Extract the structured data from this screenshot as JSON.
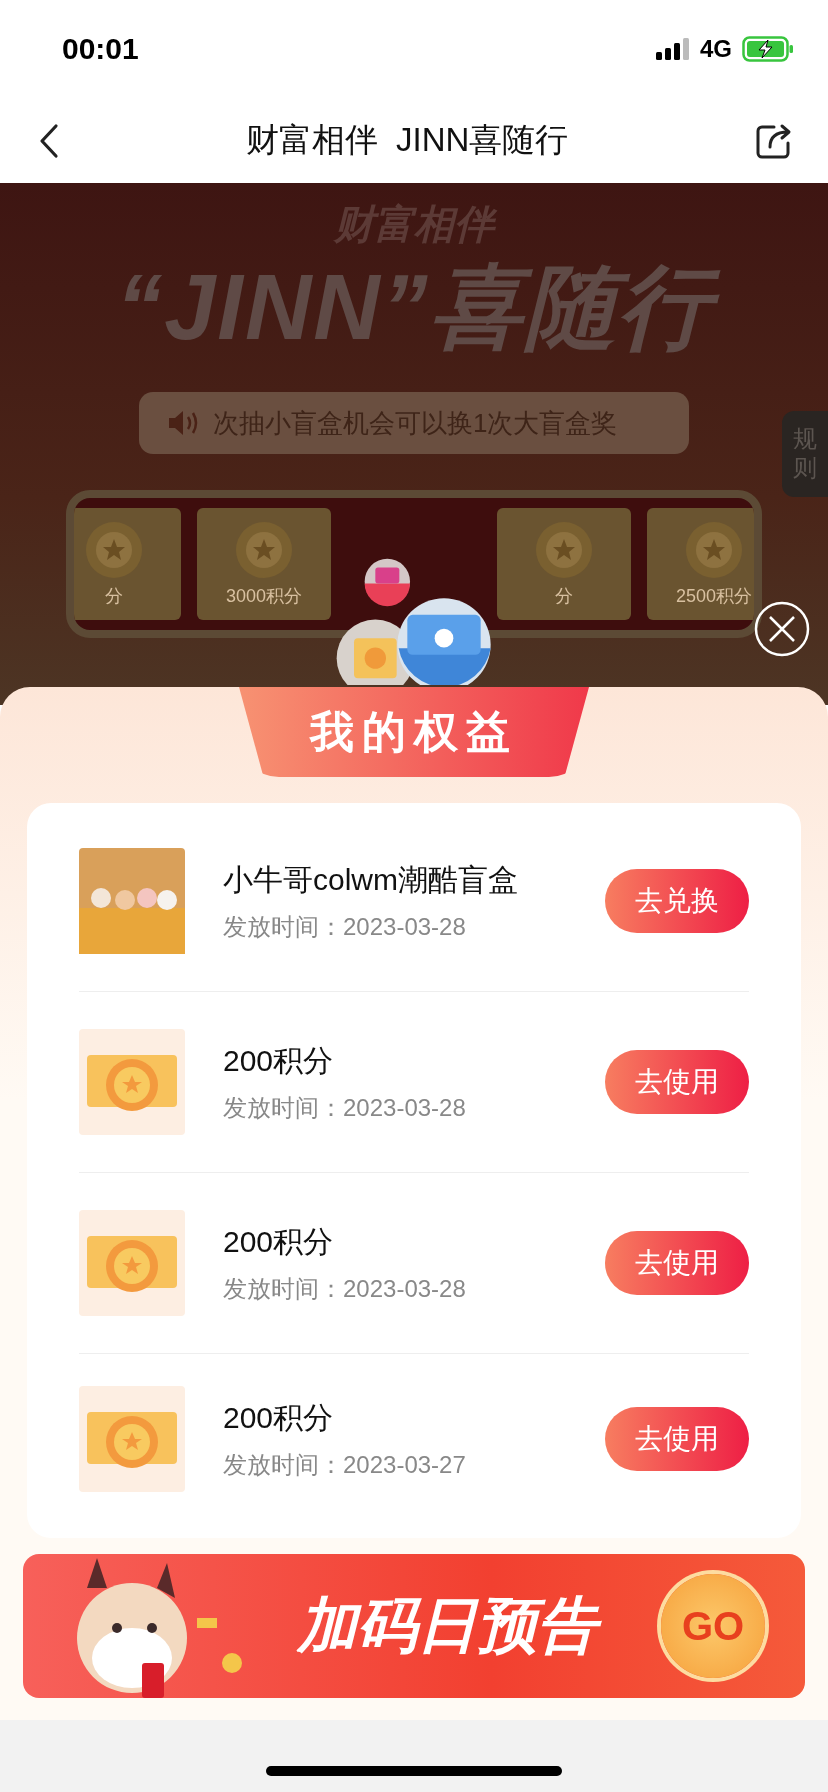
{
  "status_bar": {
    "time": "00:01",
    "network": "4G"
  },
  "nav": {
    "title": "财富相伴  JINN喜随行"
  },
  "background": {
    "subtitle": "财富相伴",
    "title": "“JINN”喜随行",
    "notice": "次抽小盲盒机会可以换1次大盲盒奖",
    "rules_tab": "规则",
    "prizes": [
      {
        "label": "分"
      },
      {
        "label": "3000积分"
      },
      {
        "label": "分"
      },
      {
        "label": "2500积分"
      }
    ]
  },
  "sheet": {
    "title": "我的权益",
    "items": [
      {
        "kind": "figure",
        "name": "小牛哥colwm潮酷盲盒",
        "date": "发放时间：2023-03-28",
        "action": "去兑换"
      },
      {
        "kind": "points",
        "name": "200积分",
        "date": "发放时间：2023-03-28",
        "action": "去使用"
      },
      {
        "kind": "points",
        "name": "200积分",
        "date": "发放时间：2023-03-28",
        "action": "去使用"
      },
      {
        "kind": "points",
        "name": "200积分",
        "date": "发放时间：2023-03-27",
        "action": "去使用"
      }
    ]
  },
  "banner": {
    "text": "加码日预告",
    "button": "GO"
  }
}
